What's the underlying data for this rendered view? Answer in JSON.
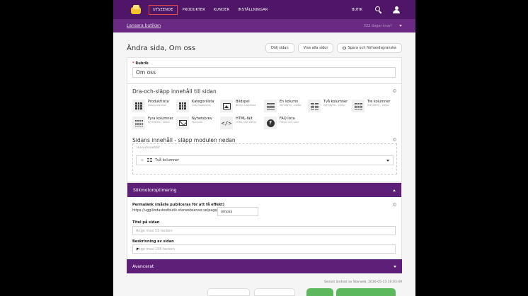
{
  "nav": {
    "items": [
      "UTSEENDE",
      "PRODUKTER",
      "KUNDER",
      "INSTÄLLNINGAR"
    ],
    "right_label": "BUTIK"
  },
  "subbar": {
    "launch": "Lansera butiken",
    "days": "322 dagar kvar!"
  },
  "page": {
    "title": "Ändra sida, Om oss",
    "buttons": [
      "Dölj sidan",
      "Visa alla sidor",
      "Spara och förhandsgranska"
    ]
  },
  "rubrik": {
    "label": "Rubrik",
    "required_mark": "*",
    "value": "Om oss"
  },
  "drag": {
    "title": "Dra-och-släpp innehåll till sidan",
    "info": "i",
    "modules": [
      {
        "title": "Produktlista",
        "sub": "Lista produkter",
        "icon": "grid-icon"
      },
      {
        "title": "Kategorilista",
        "sub": "Lista Kategorier",
        "icon": "grid-icon"
      },
      {
        "title": "Bildspel",
        "sub": "Bilder & bildtext",
        "icon": "image-icon"
      },
      {
        "title": "En kolumn",
        "sub": "WYSIWYG - editor",
        "icon": "one-column-icon"
      },
      {
        "title": "Två kolumner",
        "sub": "WYSIWYG - editor",
        "icon": "two-columns-icon"
      },
      {
        "title": "Tre kolumner",
        "sub": "WYSIWYG - editor",
        "icon": "three-columns-icon"
      },
      {
        "title": "Fyra kolumner",
        "sub": "WYSIWYG - editor",
        "icon": "four-columns-icon"
      },
      {
        "title": "Nyhetsbrev",
        "sub": "Formulär",
        "icon": "envelope-icon"
      },
      {
        "title": "HTML-fält",
        "sub": "HTML text-editor",
        "icon": "code-icon"
      },
      {
        "title": "FAQ lista",
        "sub": "Frågor och svar",
        "icon": "question-icon"
      }
    ]
  },
  "content": {
    "title": "Sidans innehåll - släpp modulen nedan",
    "info": "i",
    "zone_label": "Huvudinnehåll",
    "item": "Två kolumner"
  },
  "seo": {
    "title": "Sökmotoroptimering",
    "permalink_label": "Permalänk (måste publiceras för att få effekt)",
    "permalink_info": "i",
    "permalink_prefix": "https://uggilindastestbutik.starwebserver.se/page/",
    "permalink_value": "omoss",
    "page_title_label": "Titel på sidan",
    "page_title_placeholder": "Ange max 55 tecken",
    "description_label": "Beskrivning av sidan",
    "description_placeholder": "Ange max 156 tecken"
  },
  "advanced": {
    "title": "Avancerat"
  },
  "footer": {
    "last_changed": "Senast ändrad av Starweb, 2016-05-13 10:03:49"
  },
  "colors": {
    "topnav": "#4f1566",
    "subbar": "#6a2a83",
    "section_bar": "#5d1f78",
    "accent_red": "#e24b4b",
    "save_green": "#5cb85c"
  }
}
